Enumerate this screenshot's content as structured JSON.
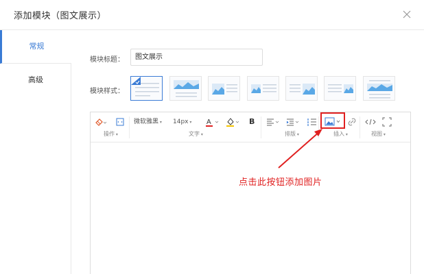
{
  "dialog": {
    "title": "添加模块（图文展示）"
  },
  "sidebar": {
    "items": [
      {
        "label": "常规"
      },
      {
        "label": "高级"
      }
    ]
  },
  "form": {
    "title_label": "模块标题：",
    "title_value": "图文展示",
    "style_label": "模块样式："
  },
  "toolbar": {
    "font_family": "微软雅黑",
    "font_size": "14px",
    "bold": "B",
    "groups": {
      "operate": "操作",
      "text": "文字",
      "layout": "排版",
      "insert": "插入",
      "view": "视图"
    }
  },
  "annotation": "点击此按钮添加图片",
  "colors": {
    "accent": "#3a7bd5",
    "highlight": "#e02020"
  }
}
